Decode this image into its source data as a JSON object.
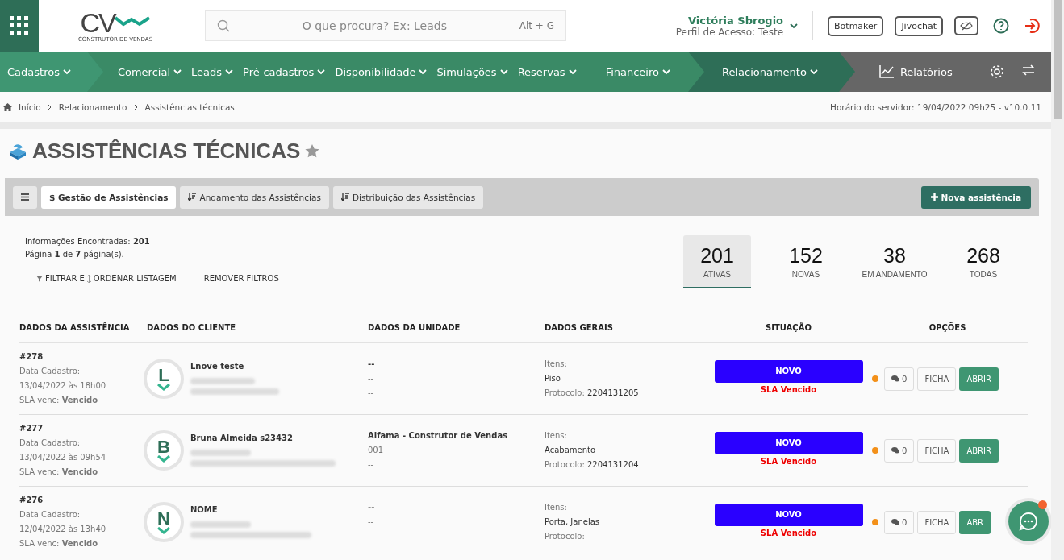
{
  "header": {
    "logo": {
      "mark": "CV",
      "tagline": "CONSTRUTOR DE VENDAS"
    },
    "search": {
      "placeholder": "O que procura? Ex: Leads",
      "shortcut": "Alt + G"
    },
    "user": {
      "name": "Victória Sbrogio",
      "profile": "Perfil de Acesso: Teste"
    },
    "buttons": [
      "Botmaker",
      "Jivochat"
    ]
  },
  "nav": [
    {
      "label": "Cadastros",
      "highlighted": true,
      "selected": false
    },
    {
      "label": "Comercial",
      "highlighted": false,
      "selected": false
    },
    {
      "label": "Leads",
      "highlighted": false,
      "selected": false
    },
    {
      "label": "Pré-cadastros",
      "highlighted": false,
      "selected": false
    },
    {
      "label": "Disponibilidade",
      "highlighted": false,
      "selected": false
    },
    {
      "label": "Simulações",
      "highlighted": false,
      "selected": false
    },
    {
      "label": "Reservas",
      "highlighted": false,
      "selected": false
    },
    {
      "label": "Financeiro",
      "highlighted": false,
      "selected": false
    },
    {
      "label": "Relacionamento",
      "highlighted": false,
      "selected": true
    }
  ],
  "reports": {
    "label": "Relatórios"
  },
  "breadcrumb": [
    "Início",
    "Relacionamento",
    "Assistências técnicas"
  ],
  "server_time": "Horário do servidor: 19/04/2022 09h25 - v10.0.11",
  "page_title": "ASSISTÊNCIAS TÉCNICAS",
  "toolbar": {
    "tabs": [
      {
        "label": "$ Gestão de Assistências",
        "selected": true
      },
      {
        "label": "Andamento das Assistências",
        "selected": false
      },
      {
        "label": "Distribuição das Assistências",
        "selected": false
      }
    ],
    "new_button": "Nova assistência"
  },
  "summary": {
    "found": "Informações Encontradas: **201**",
    "page": "Página **1** de **7** página(s)."
  },
  "filters": [
    "FILTRAR E",
    "ORDENAR LISTAGEM",
    "REMOVER FILTROS"
  ],
  "stats": [
    {
      "value": "201",
      "label": "ATIVAS",
      "selected": true
    },
    {
      "value": "152",
      "label": "NOVAS",
      "selected": false
    },
    {
      "value": "38",
      "label": "EM ANDAMENTO",
      "selected": false
    },
    {
      "value": "268",
      "label": "TODAS",
      "selected": false
    }
  ],
  "table": {
    "columns": [
      "DADOS DA ASSISTÊNCIA",
      "DADOS DO CLIENTE",
      "DADOS DA UNIDADE",
      "DADOS GERAIS",
      "SITUAÇÃO",
      "OPÇÕES"
    ],
    "rows": [
      {
        "id": "#278",
        "date_label": "Data Cadastro:",
        "date": "13/04/2022 às 18h00",
        "sla_label": "SLA venc:",
        "sla": "Vencido",
        "initial": "L",
        "client": "Lnove teste",
        "unit": [
          "--",
          "--",
          "--"
        ],
        "items_label": "Itens:",
        "items": "Piso",
        "protocol_label": "Protocolo:",
        "protocol": "2204131205",
        "status": "NOVO",
        "sla_status": "SLA Vencido",
        "comments": "0",
        "ficha": "FICHA",
        "open": "ABRIR"
      },
      {
        "id": "#277",
        "date_label": "Data Cadastro:",
        "date": "13/04/2022 às 09h54",
        "sla_label": "SLA venc:",
        "sla": "Vencido",
        "initial": "B",
        "client": "Bruna Almeida s23432",
        "unit": [
          "Alfama - Construtor de Vendas",
          "001",
          "--"
        ],
        "items_label": "Itens:",
        "items": "Acabamento",
        "protocol_label": "Protocolo:",
        "protocol": "2204131204",
        "status": "NOVO",
        "sla_status": "SLA Vencido",
        "comments": "0",
        "ficha": "FICHA",
        "open": "ABRIR"
      },
      {
        "id": "#276",
        "date_label": "Data Cadastro:",
        "date": "12/04/2022 às 13h40",
        "sla_label": "SLA venc:",
        "sla": "Vencido",
        "initial": "N",
        "client": "NOME",
        "unit": [
          "--",
          "--",
          "--"
        ],
        "items_label": "Itens:",
        "items": "Porta, Janelas",
        "protocol_label": "Protocolo:",
        "protocol": "--",
        "status": "NOVO",
        "sla_status": "SLA Vencido",
        "comments": "0",
        "ficha": "FICHA",
        "open": "ABR"
      }
    ]
  }
}
